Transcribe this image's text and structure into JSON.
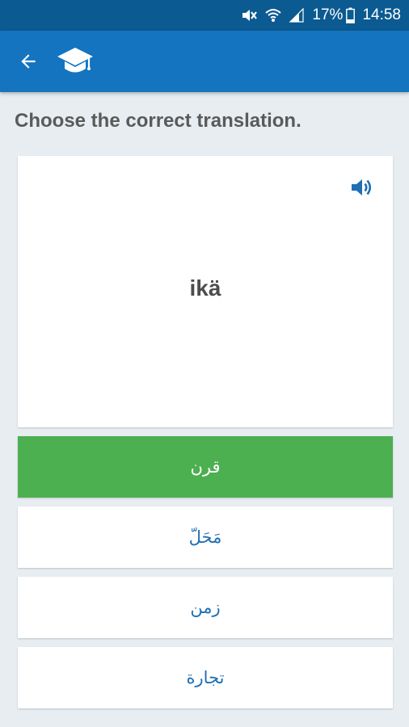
{
  "status_bar": {
    "battery": "17%",
    "time": "14:58",
    "icons": [
      "mute-icon",
      "wifi-icon",
      "signal-icon",
      "battery-icon"
    ]
  },
  "app_bar": {
    "icons": [
      "back-arrow-icon",
      "graduation-cap-icon"
    ],
    "color": "#1474c0"
  },
  "quiz": {
    "prompt": "Choose the correct translation.",
    "word": "ikä",
    "speaker_icon": "speaker-icon",
    "answers": [
      {
        "text": "قرن",
        "state": "correct"
      },
      {
        "text": "مَحَلّ",
        "state": "default"
      },
      {
        "text": "زمن",
        "state": "default"
      },
      {
        "text": "تجارة",
        "state": "default"
      }
    ]
  },
  "colors": {
    "status_bar": "#0b5a91",
    "app_bar": "#1474c0",
    "correct": "#4caf50",
    "answer_text": "#1f6fb5",
    "background": "#e7edf1"
  }
}
